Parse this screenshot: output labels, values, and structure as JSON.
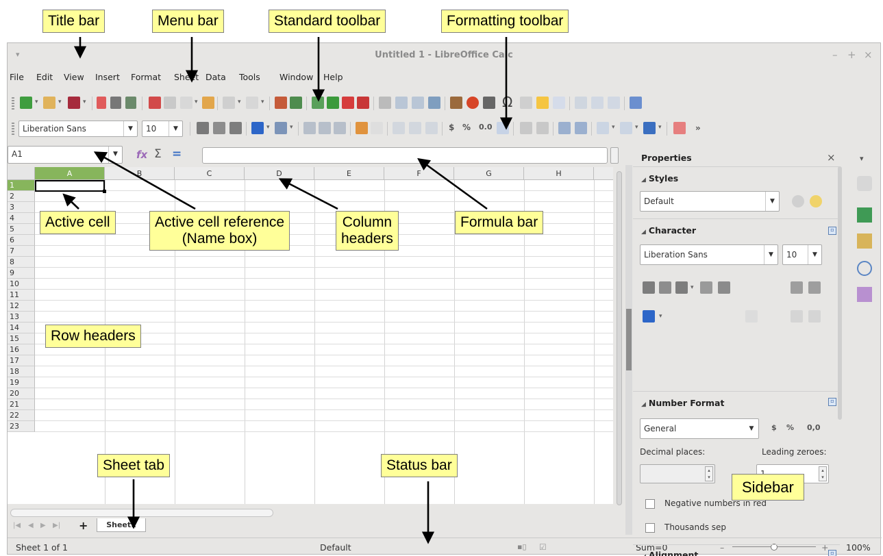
{
  "callouts": {
    "title_bar": "Title bar",
    "menu_bar": "Menu bar",
    "standard_toolbar": "Standard toolbar",
    "formatting_toolbar": "Formatting toolbar",
    "active_cell": "Active cell",
    "active_cell_reference_line1": "Active cell reference",
    "active_cell_reference_line2": "(Name box)",
    "column_headers_line1": "Column",
    "column_headers_line2": "headers",
    "formula_bar": "Formula bar",
    "row_headers": "Row headers",
    "sheet_tab": "Sheet tab",
    "status_bar": "Status bar",
    "sidebar": "Sidebar"
  },
  "window": {
    "title": "Untitled 1 - LibreOffice Calc",
    "sys_menu_glyph": "▾",
    "minimize_glyph": "–",
    "maximize_glyph": "+",
    "close_glyph": "×"
  },
  "menu": [
    "File",
    "Edit",
    "View",
    "Insert",
    "Format",
    "Sheet",
    "Data",
    "Tools",
    "Window",
    "Help"
  ],
  "formatting": {
    "font_name": "Liberation Sans",
    "font_size": "10",
    "currency": "$",
    "percent": "%",
    "number": "0.0",
    "more": "»"
  },
  "formula_bar": {
    "name_box_value": "A1",
    "function_wizard": "fx",
    "sum": "Σ",
    "equals": "=",
    "formula_value": ""
  },
  "grid": {
    "columns": [
      "A",
      "B",
      "C",
      "D",
      "E",
      "F",
      "G",
      "H"
    ],
    "rows": [
      "1",
      "2",
      "3",
      "4",
      "5",
      "6",
      "7",
      "8",
      "9",
      "10",
      "11",
      "12",
      "13",
      "14",
      "15",
      "16",
      "17",
      "18",
      "19",
      "20",
      "21",
      "22",
      "23"
    ],
    "active_cell": "A1"
  },
  "sheet_tabs": {
    "add_glyph": "+",
    "tabs": [
      "Sheet1"
    ]
  },
  "status": {
    "sheet_position": "Sheet 1 of 1",
    "page_style": "Default",
    "sum": "Sum=0",
    "zoom": "100%",
    "zoom_minus": "–",
    "zoom_plus": "+",
    "zoom_level": 0.5
  },
  "sidebar": {
    "title": "Properties",
    "close_glyph": "×",
    "styles_header": "Styles",
    "style_value": "Default",
    "character_header": "Character",
    "char_font": "Liberation Sans",
    "char_size": "10",
    "number_format_header": "Number Format",
    "number_category": "General",
    "currency": "$",
    "percent": "%",
    "number": "0,0",
    "decimal_places_label": "Decimal places:",
    "leading_zeroes_label": "Leading zeroes:",
    "decimal_places_value": "",
    "leading_zeroes_value": "1",
    "negative_red_label": "Negative numbers in red",
    "thousands_sep_label": "Thousands sep",
    "alignment_header": "Alignment"
  }
}
